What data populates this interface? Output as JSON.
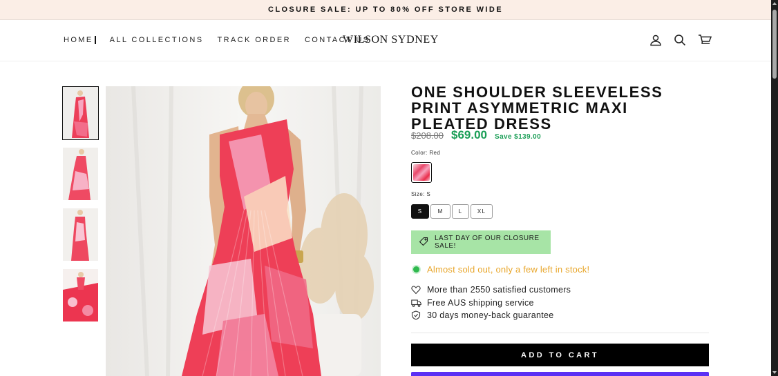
{
  "announcement": "CLOSURE SALE: UP TO 80% OFF STORE WIDE",
  "nav": [
    {
      "label": "HOME"
    },
    {
      "label": "ALL COLLECTIONS"
    },
    {
      "label": "TRACK ORDER"
    },
    {
      "label": "CONTACT US"
    }
  ],
  "logo": "WILSON SYDNEY",
  "header_icons": [
    "account-icon",
    "search-icon",
    "cart-icon"
  ],
  "product": {
    "title": "ONE SHOULDER SLEEVELESS PRINT ASYMMETRIC MAXI PLEATED DRESS",
    "old_price": "$208.00",
    "price": "$69.00",
    "save": "Save $139.00",
    "color_label": "Color: Red",
    "size_label": "Size: S",
    "sizes": [
      "S",
      "M",
      "L",
      "XL"
    ],
    "selected_size": "S",
    "promo": "LAST DAY OF OUR CLOSURE SALE!",
    "stock": "Almost sold out, only a few left in stock!",
    "features": [
      {
        "icon": "heart-icon",
        "text": "More than 2550 satisfied customers"
      },
      {
        "icon": "truck-icon",
        "text": "Free AUS shipping service"
      },
      {
        "icon": "shield-check-icon",
        "text": "30 days money-back guarantee"
      }
    ],
    "add_to_cart": "ADD TO CART"
  },
  "colors": {
    "announcement_bg": "#fbeee6",
    "sale_green": "#1a9e56",
    "promo_bg": "#a7e4a6",
    "stock_orange": "#e8a62b",
    "pay_button": "#5a31f4"
  }
}
